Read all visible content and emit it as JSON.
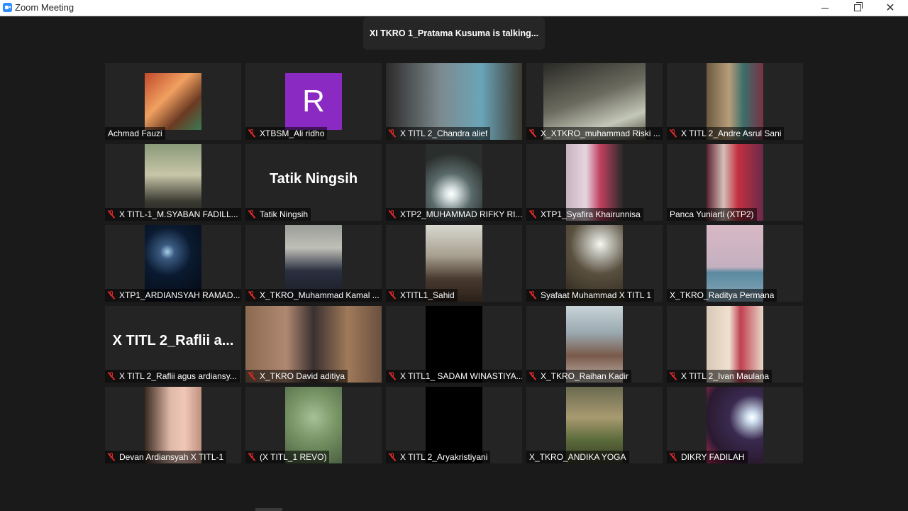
{
  "window": {
    "title": "Zoom Meeting"
  },
  "banner": {
    "text": "XI TKRO 1_Pratama Kusuma is talking..."
  },
  "participants": [
    {
      "name": "Achmad Fauzi",
      "muted": false
    },
    {
      "name": "XTBSM_Ali ridho",
      "muted": true
    },
    {
      "name": "X TITL 2_Chandra alief",
      "muted": true
    },
    {
      "name": "X_XTKRO_muhammad Riski ...",
      "muted": true
    },
    {
      "name": "X TITL 2_Andre Asrul Sani",
      "muted": true
    },
    {
      "name": "X TITL-1_M.SYABAN FADILL...",
      "muted": true
    },
    {
      "name": "Tatik Ningsih",
      "muted": true
    },
    {
      "name": "XTP2_MUHAMMAD RIFKY RI...",
      "muted": true
    },
    {
      "name": "XTP1_Syafira Khairunnisa",
      "muted": true
    },
    {
      "name": "Panca Yuniarti (XTP2)",
      "muted": false
    },
    {
      "name": "XTP1_ARDIANSYAH RAMAD...",
      "muted": true
    },
    {
      "name": "X_TKRO_Muhammad Kamal ...",
      "muted": true
    },
    {
      "name": "XTITL1_Sahid",
      "muted": true
    },
    {
      "name": "Syafaat Muhammad X TITL 1",
      "muted": true
    },
    {
      "name": "X_TKRO_Raditya Permana",
      "muted": false
    },
    {
      "name": "X TITL 2_Raflii agus ardiansy...",
      "muted": true
    },
    {
      "name": "X_TKRO David aditiya",
      "muted": true
    },
    {
      "name": "X TITL1_ SADAM WINASTIYA...",
      "muted": true
    },
    {
      "name": "X_TKRO_Raihan Kadir",
      "muted": true
    },
    {
      "name": "X TITL 2_Ivan Maulana",
      "muted": true
    },
    {
      "name": "Devan Ardiansyah X TITL-1",
      "muted": true
    },
    {
      "name": "(X TITL_1 REVO)",
      "muted": true
    },
    {
      "name": "X TITL 2_Aryakristiyani",
      "muted": true
    },
    {
      "name": "X_TKRO_ANDIKA YOGA",
      "muted": false
    },
    {
      "name": "DIKRY FADILAH",
      "muted": true
    }
  ],
  "placeholders": {
    "avatar_letter": "R",
    "tatik_display": "Tatik Ningsih",
    "raflii_display": "X TITL 2_Raflii a..."
  },
  "colors": {
    "background": "#1a1a1a",
    "tile": "#242424",
    "muted_icon": "#e02828",
    "avatar": "#8a2ac2"
  }
}
